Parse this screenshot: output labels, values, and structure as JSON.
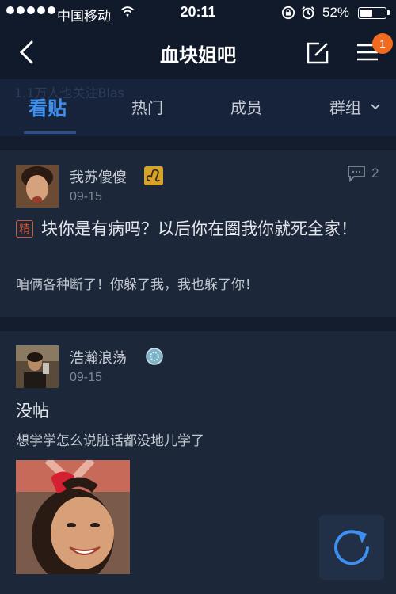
{
  "status_bar": {
    "carrier": "中国移动",
    "time": "20:11",
    "battery_percent": "52%",
    "battery_level": 0.52
  },
  "nav": {
    "title": "血块姐吧",
    "notification_count": "1"
  },
  "tabs": {
    "ghost_text": "1.1万人也关注Blas",
    "items": [
      "看贴",
      "热门",
      "成员",
      "群组"
    ],
    "active_index": 0
  },
  "posts": [
    {
      "username": "我苏傻傻",
      "badge_icon": "leo-zodiac-icon",
      "date": "09-15",
      "reply_count": "2",
      "tag": "精",
      "title": "块你是有病吗？以后你在圈我你就死全家！",
      "body": "咱俩各种断了！你躲了我，我也躲了你！"
    },
    {
      "username": "浩瀚浪荡",
      "badge_icon": "level-badge-icon",
      "date": "09-15",
      "title": "没帖",
      "body": "想学学怎么说脏话都没地儿学了"
    }
  ],
  "colors": {
    "background": "#1a2438",
    "accent": "#3e90f0",
    "badge": "#f06a1f"
  }
}
